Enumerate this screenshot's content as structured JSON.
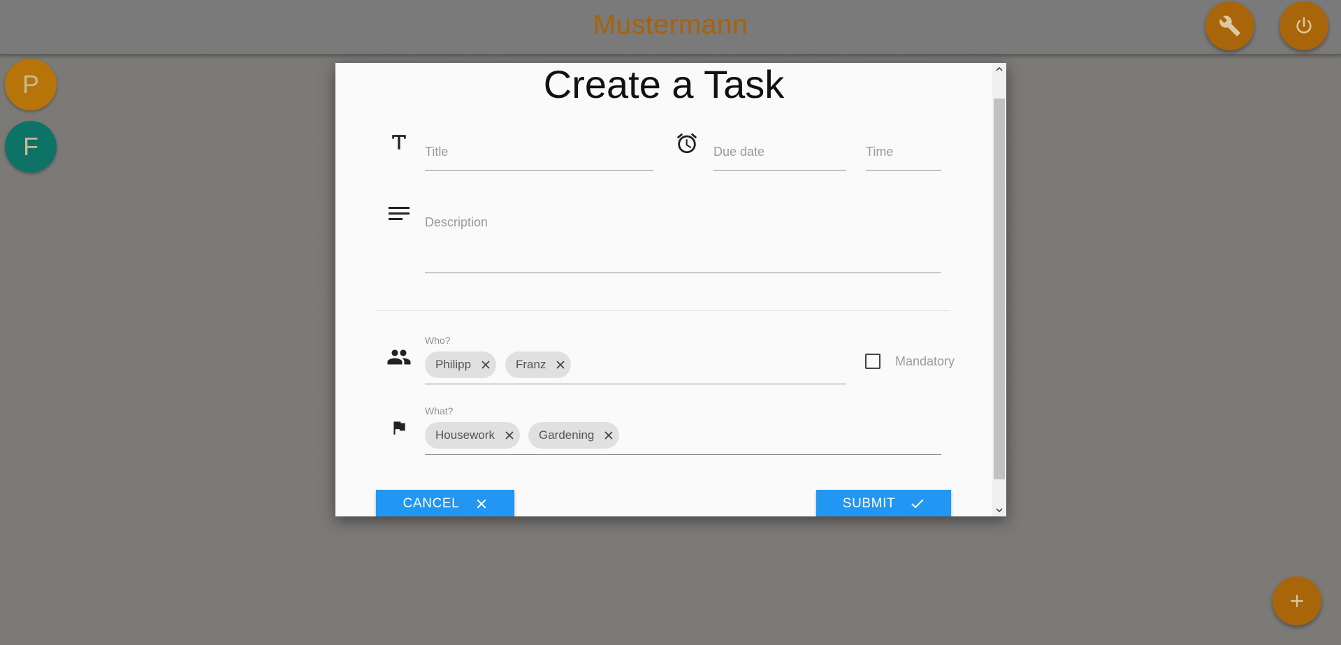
{
  "app": {
    "title": "Mustermann"
  },
  "toolbar": {
    "settings_icon": "wrench-icon",
    "power_icon": "power-icon"
  },
  "sidebar": {
    "avatars": [
      {
        "letter": "P",
        "color": "#b77409"
      },
      {
        "letter": "F",
        "color": "#0d7366"
      }
    ]
  },
  "dialog": {
    "title": "Create a Task",
    "fields": {
      "title": {
        "placeholder": "Title",
        "value": ""
      },
      "due_date": {
        "placeholder": "Due date",
        "value": ""
      },
      "time": {
        "placeholder": "Time",
        "value": ""
      },
      "description": {
        "placeholder": "Description",
        "value": ""
      }
    },
    "who": {
      "label": "Who?",
      "chips": [
        "Philipp",
        "Franz"
      ]
    },
    "mandatory": {
      "label": "Mandatory",
      "checked": false
    },
    "what": {
      "label": "What?",
      "chips": [
        "Housework",
        "Gardening"
      ]
    },
    "buttons": {
      "cancel": "CANCEL",
      "submit": "SUBMIT"
    }
  },
  "fab": {
    "icon": "plus-icon"
  },
  "colors": {
    "accent": "#a96509",
    "primary_button": "#2196f3",
    "title_text": "#a96208"
  }
}
